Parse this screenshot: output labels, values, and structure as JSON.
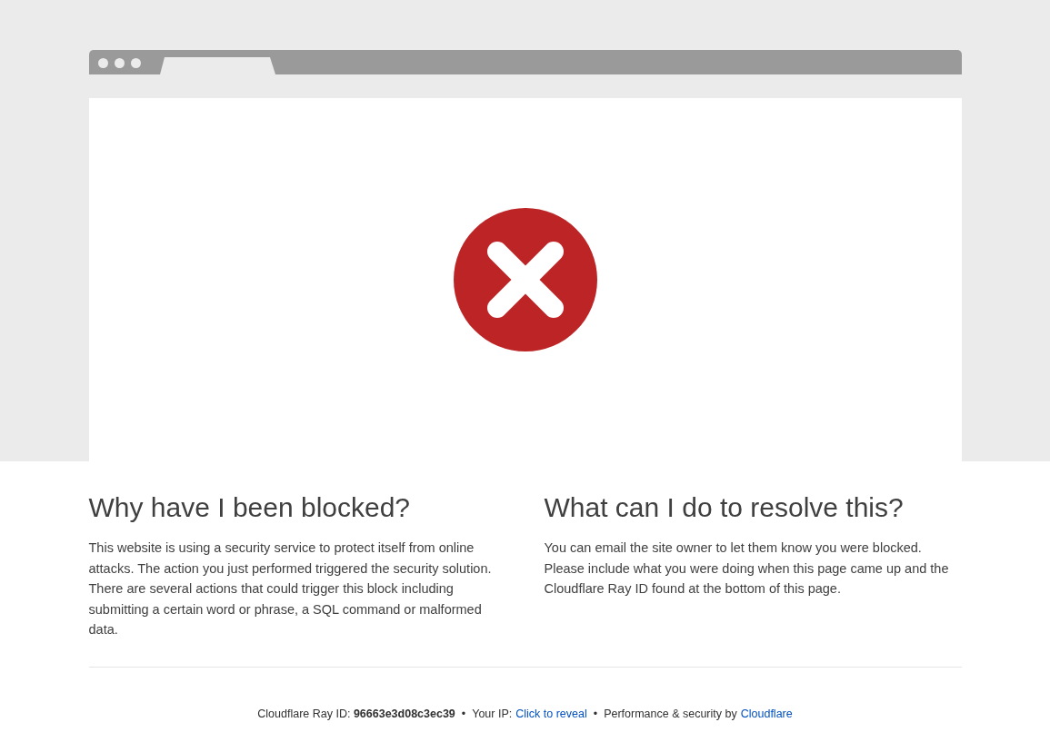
{
  "sections": [
    {
      "heading": "Why have I been blocked?",
      "text": "This website is using a security service to protect itself from online attacks. The action you just performed triggered the security solution. There are several actions that could trigger this block including submitting a certain word or phrase, a SQL command or malformed data."
    },
    {
      "heading": "What can I do to resolve this?",
      "text": "You can email the site owner to let them know you were blocked. Please include what you were doing when this page came up and the Cloudflare Ray ID found at the bottom of this page."
    }
  ],
  "footer": {
    "ray_id": "Cloudflare Ray ID: **96663e3d08c3ec39**",
    "separator_1": "•",
    "ip_label": "Your IP:",
    "ip_link": "Click to reveal",
    "separator_2": "•",
    "credit": "Performance & security by",
    "credit_link": "Cloudflare"
  }
}
